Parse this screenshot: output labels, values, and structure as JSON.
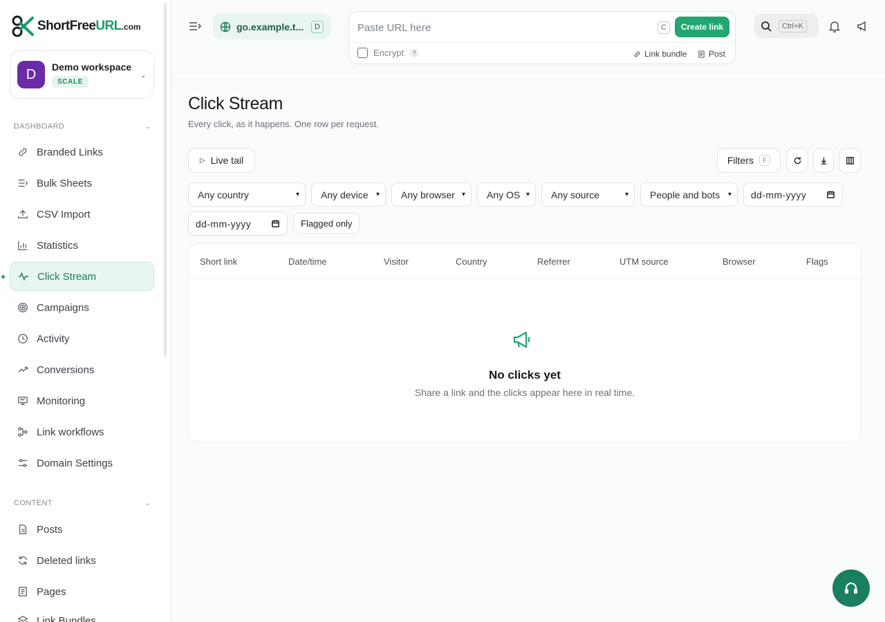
{
  "brand": {
    "short_free": "ShortFree",
    "url": "URL",
    "com": ".com"
  },
  "workspace": {
    "initial": "D",
    "name": "Demo workspace",
    "plan": "SCALE"
  },
  "sidebar": {
    "dashboard_label": "DASHBOARD",
    "content_label": "CONTENT",
    "items": [
      {
        "label": "Branded Links",
        "icon": "link-icon"
      },
      {
        "label": "Bulk Sheets",
        "icon": "bulk-list-icon"
      },
      {
        "label": "CSV Import",
        "icon": "upload-icon"
      },
      {
        "label": "Statistics",
        "icon": "bar-chart-icon"
      },
      {
        "label": "Click Stream",
        "icon": "pulse-icon",
        "active": true
      },
      {
        "label": "Campaigns",
        "icon": "target-icon"
      },
      {
        "label": "Activity",
        "icon": "clock-icon"
      },
      {
        "label": "Conversions",
        "icon": "trend-up-icon"
      },
      {
        "label": "Monitoring",
        "icon": "monitor-icon"
      },
      {
        "label": "Link workflows",
        "icon": "workflow-icon"
      },
      {
        "label": "Domain Settings",
        "icon": "sliders-icon"
      }
    ],
    "content_items": [
      {
        "label": "Posts",
        "icon": "document-icon"
      },
      {
        "label": "Deleted links",
        "icon": "refresh-icon"
      },
      {
        "label": "Pages",
        "icon": "page-icon"
      },
      {
        "label": "Link Bundles",
        "icon": "layers-icon"
      }
    ]
  },
  "header": {
    "domain": "go.example.t...",
    "domain_kbd": "D",
    "url_placeholder": "Paste URL here",
    "url_kbd": "C",
    "create_label": "Create link",
    "encrypt_label": "Encrypt",
    "help": "?",
    "link_bundle_label": "Link bundle",
    "post_label": "Post",
    "search_kbd": "Ctrl+K"
  },
  "page": {
    "title": "Click Stream",
    "subtitle": "Every click, as it happens. One row per request.",
    "live_tail_label": "Live tail",
    "filters_label": "Filters",
    "filters_kbd": "F",
    "filters": [
      "Any country",
      "Any device",
      "Any browser",
      "Any OS",
      "Any source",
      "People and bots"
    ],
    "date_placeholder": "dd-mm-yyyy",
    "flagged_label": "Flagged only"
  },
  "table": {
    "columns": [
      "Short link",
      "Date/time",
      "Visitor",
      "Country",
      "Referrer",
      "UTM source",
      "Browser",
      "Flags"
    ],
    "empty_title": "No clicks yet",
    "empty_subtitle": "Share a link and the clicks appear here in real time."
  },
  "colors": {
    "accent": "#22a672",
    "accent_dark": "#1a7f5f",
    "workspace_avatar": "#6b2aa8"
  }
}
